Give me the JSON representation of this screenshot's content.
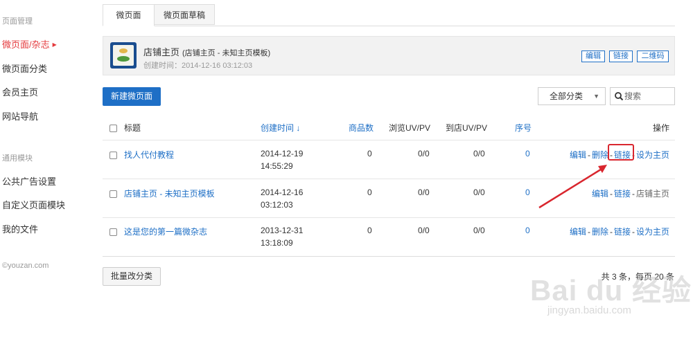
{
  "sidebar": {
    "group1_label": "页面管理",
    "items1": [
      {
        "label": "微页面/杂志",
        "active": true
      },
      {
        "label": "微页面分类"
      },
      {
        "label": "会员主页"
      },
      {
        "label": "网站导航"
      }
    ],
    "group2_label": "通用模块",
    "items2": [
      {
        "label": "公共广告设置"
      },
      {
        "label": "自定义页面模块"
      },
      {
        "label": "我的文件"
      }
    ],
    "copyright": "©youzan.com"
  },
  "tabs": [
    {
      "label": "微页面",
      "active": true
    },
    {
      "label": "微页面草稿"
    }
  ],
  "home": {
    "title": "店铺主页",
    "subtitle": "(店铺主页 - 未知主页模板)",
    "created": "创建时间：2014-12-16 03:12:03",
    "buttons": [
      "编辑",
      "链接",
      "二维码"
    ]
  },
  "toolbar": {
    "new_button": "新建微页面",
    "category_select": "全部分类",
    "search_placeholder": "搜索"
  },
  "table": {
    "headers": {
      "title": "标题",
      "created": "创建时间 ↓",
      "goods": "商品数",
      "uvpv": "浏览UV/PV",
      "store_uvpv": "到店UV/PV",
      "order": "序号",
      "ops": "操作"
    },
    "rows": [
      {
        "title": "找人代付教程",
        "date": "2014-12-19",
        "time": "14:55:29",
        "goods": "0",
        "uvpv": "0/0",
        "store": "0/0",
        "order": "0",
        "ops": [
          "编辑",
          "删除",
          "链接",
          "设为主页"
        ]
      },
      {
        "title": "店铺主页 - 未知主页模板",
        "date": "2014-12-16",
        "time": "03:12:03",
        "goods": "0",
        "uvpv": "0/0",
        "store": "0/0",
        "order": "0",
        "ops": [
          "编辑",
          "链接",
          "店铺主页"
        ]
      },
      {
        "title": "这是您的第一篇微杂志",
        "date": "2013-12-31",
        "time": "13:18:09",
        "goods": "0",
        "uvpv": "0/0",
        "store": "0/0",
        "order": "0",
        "ops": [
          "编辑",
          "删除",
          "链接",
          "设为主页"
        ]
      }
    ]
  },
  "footer": {
    "batch_button": "批量改分类",
    "pager": "共 3 条，每页 20 条"
  },
  "watermark": {
    "logo": "Bai du 经验",
    "url": "jingyan.baidu.com"
  },
  "colors": {
    "link": "#1e6fc6",
    "active_nav": "#e4393c",
    "annotation": "#d9262e"
  }
}
